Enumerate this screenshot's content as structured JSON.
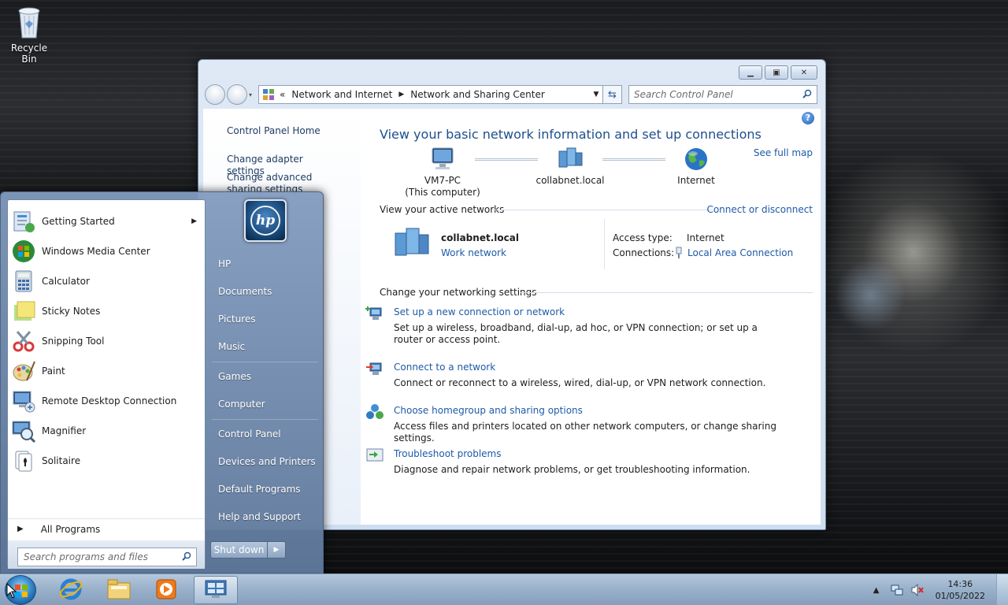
{
  "desktop": {
    "icons": [
      {
        "label": "Recycle Bin",
        "icon": "recycle-bin-icon"
      }
    ]
  },
  "window": {
    "address": {
      "icon": "control-panel-icon",
      "overflow": "«",
      "crumbs": [
        "Network and Internet",
        "Network and Sharing Center"
      ]
    },
    "search_placeholder": "Search Control Panel",
    "left_pane": {
      "home": "Control Panel Home",
      "links": [
        "Change adapter settings",
        "Change advanced sharing settings"
      ]
    },
    "heading": "View your basic network information and set up connections",
    "see_full_map": "See full map",
    "map": {
      "computer": {
        "name": "VM7-PC",
        "sub": "(This computer)"
      },
      "network": {
        "name": "collabnet.local"
      },
      "internet": {
        "name": "Internet"
      }
    },
    "active_networks": {
      "title": "View your active networks",
      "connect_link": "Connect or disconnect",
      "name": "collabnet.local",
      "type_link": "Work network",
      "access_label": "Access type:",
      "access_value": "Internet",
      "connections_label": "Connections:",
      "connections_value": "Local Area Connection"
    },
    "settings": {
      "title": "Change your networking settings",
      "tasks": [
        {
          "title": "Set up a new connection or network",
          "desc": "Set up a wireless, broadband, dial-up, ad hoc, or VPN connection; or set up a router or access point."
        },
        {
          "title": "Connect to a network",
          "desc": "Connect or reconnect to a wireless, wired, dial-up, or VPN network connection."
        },
        {
          "title": "Choose homegroup and sharing options",
          "desc": "Access files and printers located on other network computers, or change sharing settings."
        },
        {
          "title": "Troubleshoot problems",
          "desc": "Diagnose and repair network problems, or get troubleshooting information."
        }
      ]
    }
  },
  "start_menu": {
    "programs": [
      {
        "label": "Getting Started",
        "icon": "getting-started-icon",
        "has_submenu": true
      },
      {
        "label": "Windows Media Center",
        "icon": "media-center-icon"
      },
      {
        "label": "Calculator",
        "icon": "calculator-icon"
      },
      {
        "label": "Sticky Notes",
        "icon": "sticky-notes-icon"
      },
      {
        "label": "Snipping Tool",
        "icon": "snipping-tool-icon"
      },
      {
        "label": "Paint",
        "icon": "paint-icon"
      },
      {
        "label": "Remote Desktop Connection",
        "icon": "remote-desktop-icon"
      },
      {
        "label": "Magnifier",
        "icon": "magnifier-icon"
      },
      {
        "label": "Solitaire",
        "icon": "solitaire-icon"
      }
    ],
    "all_programs": "All Programs",
    "search_placeholder": "Search programs and files",
    "user_logo_text": "hp",
    "right_items": [
      "HP",
      "Documents",
      "Pictures",
      "Music",
      "Games",
      "Computer",
      "Control Panel",
      "Devices and Printers",
      "Default Programs",
      "Help and Support"
    ],
    "shutdown_label": "Shut down"
  },
  "taskbar": {
    "pinned": [
      "internet-explorer-icon",
      "windows-explorer-icon",
      "media-player-icon",
      "control-panel-icon"
    ],
    "clock_time": "14:36",
    "clock_date": "01/05/2022"
  }
}
